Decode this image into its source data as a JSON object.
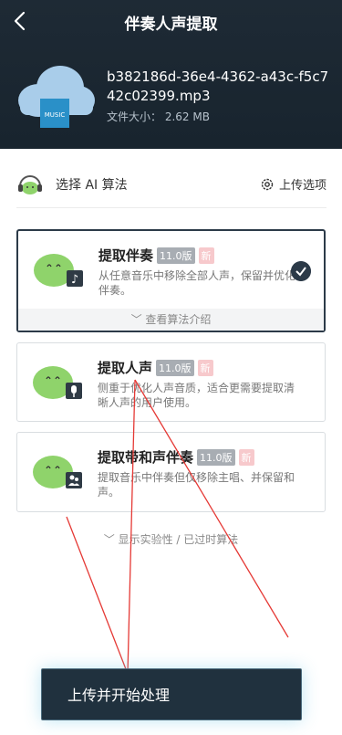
{
  "header": {
    "title": "伴奏人声提取",
    "file_name": "b382186d-36e4-4362-a43c-f5c742c02399.mp3",
    "file_size": "文件大小： 2.62 MB",
    "cloud_label": "MUSIC"
  },
  "selector": {
    "label": "选择 AI 算法",
    "upload_options": "上传选项"
  },
  "algorithms": [
    {
      "title": "提取伴奏",
      "version": "11.0版",
      "badge": "新",
      "description": "从任意音乐中移除全部人声，保留并优化伴奏。",
      "intro": "查看算法介绍",
      "icon": "music-note-icon",
      "selected": true
    },
    {
      "title": "提取人声",
      "version": "11.0版",
      "badge": "新",
      "description": "侧重于优化人声音质，适合更需要提取清晰人声的用户使用。",
      "icon": "microphone-icon",
      "selected": false
    },
    {
      "title": "提取带和声伴奏",
      "version": "11.0版",
      "badge": "新",
      "description": "提取音乐中伴奏但仅移除主唱、并保留和声。",
      "icon": "users-icon",
      "selected": false
    }
  ],
  "more_algorithms": "显示实验性 / 已过时算法",
  "action": {
    "label": "上传并开始处理"
  },
  "colors": {
    "header_bg": "#1e2a35",
    "accent": "#2c3a48",
    "face_green": "#8fd36b",
    "badge_new": "#f7c9cc",
    "annotation_red": "#e53935"
  }
}
